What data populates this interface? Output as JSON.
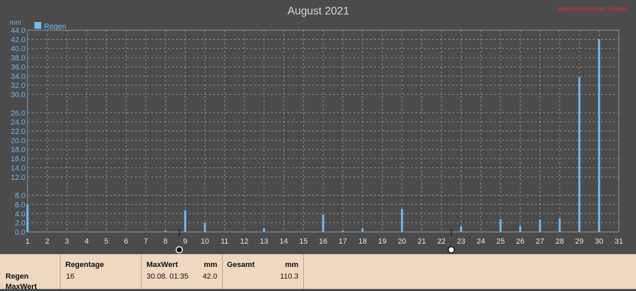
{
  "page_title": "August 2021",
  "notice": "Wettersensoren Fehler",
  "unit_label": "mm",
  "legend": {
    "label": "Regen",
    "color": "#6fb8f0"
  },
  "colors": {
    "background": "#4b4b4b",
    "bar": "#6fb8f0",
    "grid": "#8a8a8a",
    "axis": "#9a9a9a"
  },
  "chart_data": {
    "type": "bar",
    "title": "August 2021",
    "ylabel": "mm",
    "xlabel": "",
    "ylim": [
      0,
      44
    ],
    "xlim": [
      1,
      31
    ],
    "grid": true,
    "legend_position": "top-left",
    "y_ticks": [
      "44.0",
      "42.0",
      "40.0",
      "38.0",
      "36.0",
      "34.0",
      "32.0",
      "30.0",
      "26.0",
      "24.0",
      "22.0",
      "20.0",
      "18.0",
      "16.0",
      "14.0",
      "12.0",
      "8.0",
      "6.0",
      "4.0",
      "2.0",
      "0.0"
    ],
    "x_ticks": [
      "1",
      "2",
      "3",
      "4",
      "5",
      "6",
      "7",
      "8",
      "9",
      "10",
      "11",
      "12",
      "13",
      "14",
      "15",
      "16",
      "17",
      "18",
      "19",
      "20",
      "21",
      "22",
      "23",
      "24",
      "25",
      "26",
      "27",
      "28",
      "29",
      "30",
      "31"
    ],
    "series": [
      {
        "name": "Regen",
        "x": [
          1,
          8,
          9,
          10,
          13,
          16,
          17,
          18,
          20,
          23,
          25,
          26,
          27,
          28,
          29,
          30
        ],
        "values": [
          6.0,
          0.3,
          4.7,
          2.0,
          0.8,
          3.8,
          0.3,
          0.8,
          5.0,
          1.2,
          2.8,
          1.3,
          2.7,
          3.0,
          33.8,
          42.0
        ]
      }
    ],
    "markers": [
      {
        "day": 8.7,
        "icon": "new-moon-icon"
      },
      {
        "day": 22.5,
        "icon": "full-moon-icon"
      }
    ]
  },
  "summary": {
    "row_label_1": "Regen",
    "row_label_2": "MaxWert",
    "regentage_label": "Regentage",
    "regentage_value": "16",
    "maxwert_label": "MaxWert",
    "maxwert_unit": "mm",
    "maxwert_time": "30.08.  01:35",
    "maxwert_value": "42.0",
    "gesamt_label": "Gesamt",
    "gesamt_unit": "mm",
    "gesamt_value": "110.3"
  }
}
